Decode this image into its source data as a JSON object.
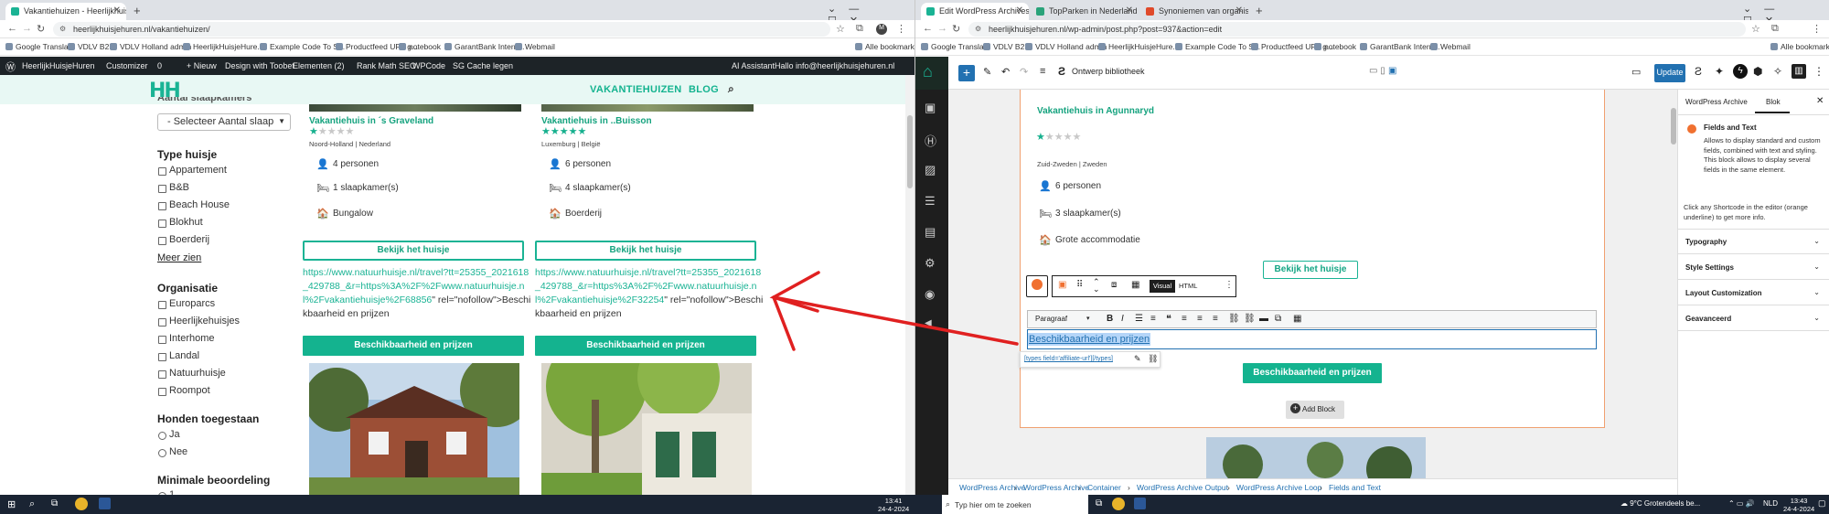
{
  "left_browser": {
    "tabs": [
      {
        "label": "Vakantiehuizen - Heerlijkhuisjes"
      }
    ],
    "url": "heerlijkhuisjehuren.nl/vakantiehuizen/",
    "bookmarks": [
      "Google Translate",
      "VDLV B2B",
      "VDLV Holland admin",
      "HeerlijkHuisjeHure...",
      "Example Code To S...",
      "Productfeed URL g...",
      "notebook",
      "GarantBank Intern...",
      "Webmail"
    ],
    "all_bookmarks": "Alle bookmarks",
    "profile": "M"
  },
  "wp_admin_bar": {
    "items": [
      "HeerlijkHuisjeHuren",
      "Customizer",
      "0",
      "+ Nieuw",
      "Design with Toobet",
      "Elementen (2)",
      "Rank Math SEO",
      "WPCode",
      "SG Cache legen"
    ],
    "ai": "AI Assistant",
    "greeting": "Hallo info@heerlijkhuisjehuren.nl"
  },
  "site": {
    "logo": "HH",
    "menu": [
      "VAKANTIEHUIZEN",
      "BLOG"
    ],
    "filters": {
      "top_cut": "Aantal slaapkamers",
      "select": "- Selecteer Aantal slaap",
      "type_title": "Type huisje",
      "types": [
        "Appartement",
        "B&B",
        "Beach House",
        "Blokhut",
        "Boerderij"
      ],
      "more": "Meer zien",
      "org_title": "Organisatie",
      "orgs": [
        "Europarcs",
        "Heerlijkehuisjes",
        "Interhome",
        "Landal",
        "Natuurhuisje",
        "Roompot"
      ],
      "dogs_title": "Honden toegestaan",
      "dogs": [
        "Ja",
        "Nee"
      ],
      "rating_title": "Minimale beoordeling",
      "rating_first": "1"
    },
    "cards": [
      {
        "title": "Vakantiehuis in ´s Graveland",
        "stars": 1,
        "location": "Noord-Holland | Nederland",
        "persons": "4 personen",
        "bedrooms": "1 slaapkamer(s)",
        "type": "Bungalow",
        "button": "Bekijk het huisje",
        "url": "https://www.natuurhuisje.nl/travel?tt=25355_2021618_429788_&r=https%3A%2F%2Fwww.natuurhuisje.nl%2Fvakantiehuisje%2F68856",
        "url_rest": "\" rel=\"nofollow\">Beschikbaarheid en prijzen",
        "cta": "Beschikbaarheid en prijzen"
      },
      {
        "title": "Vakantiehuis in ..Buisson",
        "stars": 5,
        "location": "Luxemburg | België",
        "persons": "6 personen",
        "bedrooms": "4 slaapkamer(s)",
        "type": "Boerderij",
        "button": "Bekijk het huisje",
        "url": "https://www.natuurhuisje.nl/travel?tt=25355_2021618_429788_&r=https%3A%2F%2Fwww.natuurhuisje.nl%2Fvakantiehuisje%2F32254",
        "url_rest": "\" rel=\"nofollow\">Beschikbaarheid en prijzen",
        "cta": "Beschikbaarheid en prijzen"
      }
    ]
  },
  "right_browser": {
    "tabs": [
      {
        "label": "Edit WordPress Archives Block"
      },
      {
        "label": "TopParken in Nederland — %C"
      },
      {
        "label": "Synoniemen van organisatie"
      }
    ],
    "url": "heerlijkhuisjehuren.nl/wp-admin/post.php?post=937&action=edit",
    "bookmarks": [
      "Google Translate",
      "VDLV B2B",
      "VDLV Holland admin",
      "HeerlijkHuisjeHure...",
      "Example Code To S...",
      "Productfeed URL g...",
      "notebook",
      "GarantBank Intern...",
      "Webmail"
    ],
    "all_bookmarks": "Alle bookmarks"
  },
  "editor": {
    "toolbar": {
      "library": "Ontwerp bibliotheek",
      "update": "Update"
    },
    "card": {
      "title": "Vakantiehuis in Agunnaryd",
      "stars": 1,
      "location": "Zuid-Zweden | Zweden",
      "persons": "6  personen",
      "bedrooms": "3 slaapkamer(s)",
      "type": "Grote accommodatie",
      "button": "Bekijk het huisje",
      "cta": "Beschikbaarheid en prijzen"
    },
    "block_toolbar": {
      "visual": "Visual",
      "html": "HTML"
    },
    "format": {
      "paragraph": "Paragraaf"
    },
    "selected_text": "Beschikbaarheid en prijzen",
    "link_popup": "[types field='affiliate-url'][/types]",
    "add_block": "Add Block",
    "breadcrumbs": [
      "WordPress Archive",
      "WordPress Archive",
      "Container",
      "WordPress Archive Output",
      "WordPress Archive Loop",
      "Fields and Text"
    ],
    "sidebar": {
      "tabs": [
        "WordPress Archive",
        "Blok"
      ],
      "block_title": "Fields and Text",
      "block_desc": "Allows to display standard and custom fields, combined with text and styling. This block allows to display several fields in the same element.",
      "hint": "Click any Shortcode in the editor (orange underline) to get more info.",
      "panels": [
        "Typography",
        "Style Settings",
        "Layout Customization",
        "Geavanceerd"
      ]
    }
  },
  "taskbar": {
    "left_time": "13:41",
    "left_date": "24-4-2024",
    "search": "Typ hier om te zoeken",
    "weather": "9°C  Grotendeels be...",
    "lang": "NLD",
    "right_time": "13:43",
    "right_date": "24-4-2024"
  },
  "colors": {
    "brand": "#1ab394",
    "annotation_arrow": "#e02020",
    "wp_dark": "#1d2327",
    "selection": "#2271b1"
  }
}
